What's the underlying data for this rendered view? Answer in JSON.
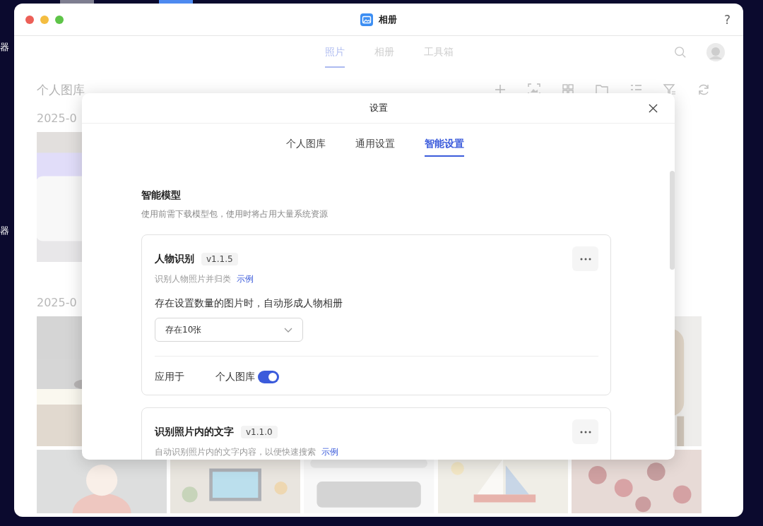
{
  "desktop": {
    "labels": [
      "器",
      "器"
    ]
  },
  "window": {
    "title": "相册",
    "help": "?"
  },
  "nav": {
    "tabs": [
      {
        "label": "照片",
        "selected": true
      },
      {
        "label": "相册",
        "selected": false
      },
      {
        "label": "工具箱",
        "selected": false
      }
    ]
  },
  "library": {
    "title": "个人图库",
    "dates": [
      "2025-0",
      "2025-0"
    ]
  },
  "dialog": {
    "title": "设置",
    "tabs": [
      {
        "label": "个人图库",
        "selected": false
      },
      {
        "label": "通用设置",
        "selected": false
      },
      {
        "label": "智能设置",
        "selected": true
      }
    ],
    "section": {
      "title": "智能模型",
      "description": "使用前需下载模型包，使用时将占用大量系统资源"
    },
    "models": [
      {
        "name": "人物识别",
        "version": "v1.1.5",
        "description": "识别人物照片并归类",
        "link": "示例",
        "threshold_label": "存在设置数量的图片时，自动形成人物相册",
        "threshold": "存在10张",
        "applies_label": "应用于",
        "targets": [
          {
            "label": "个人图库",
            "on": true
          }
        ]
      },
      {
        "name": "识别照片内的文字",
        "version": "v1.1.0",
        "description": "自动识别照片内的文字内容，以便快速搜索",
        "link": "示例"
      }
    ]
  }
}
